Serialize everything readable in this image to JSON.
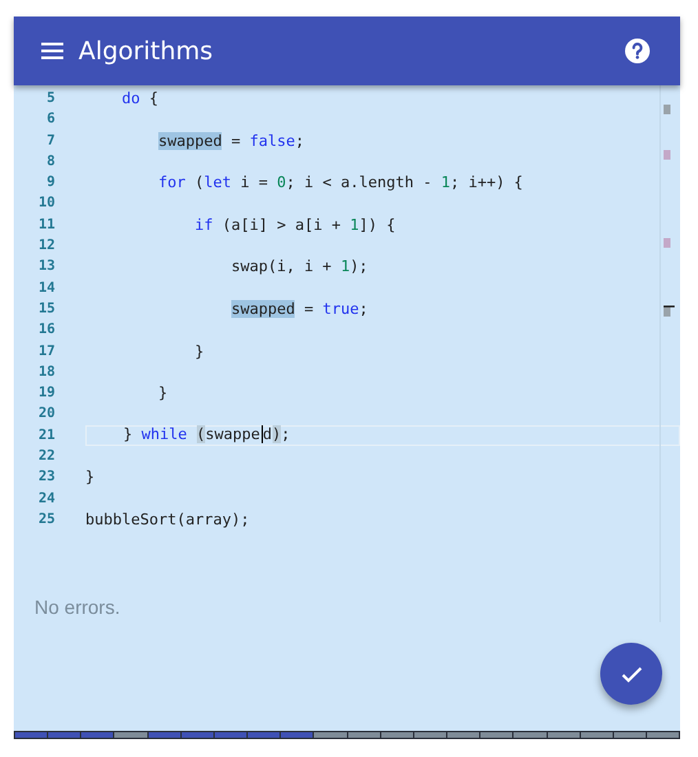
{
  "app_bar": {
    "title": "Algorithms"
  },
  "editor": {
    "lines": [
      {
        "number": "5",
        "current": false,
        "tokens": [
          {
            "text": "    do",
            "kind": "keyword"
          },
          {
            "text": " {",
            "kind": "plain"
          }
        ]
      },
      {
        "number": "6",
        "current": false
      },
      {
        "number": "7",
        "current": false,
        "tokens": [
          {
            "text": "        swapped",
            "kind": "occurrence"
          },
          {
            "text": " = ",
            "kind": "plain"
          },
          {
            "text": "false",
            "kind": "keyword"
          },
          {
            "text": ";",
            "kind": "plain"
          }
        ]
      },
      {
        "number": "8",
        "current": false
      },
      {
        "number": "9",
        "current": false,
        "tokens": [
          {
            "text": "        for",
            "kind": "keyword"
          },
          {
            "text": " (",
            "kind": "plain"
          },
          {
            "text": "let",
            "kind": "keyword"
          },
          {
            "text": " i = ",
            "kind": "plain"
          },
          {
            "text": "0",
            "kind": "number"
          },
          {
            "text": "; i < a.length - ",
            "kind": "plain"
          },
          {
            "text": "1",
            "kind": "number"
          },
          {
            "text": "; i++) {",
            "kind": "plain"
          }
        ]
      },
      {
        "number": "10",
        "current": false
      },
      {
        "number": "11",
        "current": false,
        "tokens": [
          {
            "text": "            if",
            "kind": "keyword"
          },
          {
            "text": " (a[i] > a[i + ",
            "kind": "plain"
          },
          {
            "text": "1",
            "kind": "number"
          },
          {
            "text": "]) {",
            "kind": "plain"
          }
        ]
      },
      {
        "number": "12",
        "current": false
      },
      {
        "number": "13",
        "current": false,
        "tokens": [
          {
            "text": "                swap(i, i + ",
            "kind": "plain"
          },
          {
            "text": "1",
            "kind": "number"
          },
          {
            "text": ");",
            "kind": "plain"
          }
        ]
      },
      {
        "number": "14",
        "current": false
      },
      {
        "number": "15",
        "current": false,
        "tokens": [
          {
            "text": "                swapped",
            "kind": "occurrence"
          },
          {
            "text": " = ",
            "kind": "plain"
          },
          {
            "text": "true",
            "kind": "keyword"
          },
          {
            "text": ";",
            "kind": "plain"
          }
        ]
      },
      {
        "number": "16",
        "current": false
      },
      {
        "number": "17",
        "current": false,
        "tokens": [
          {
            "text": "            }",
            "kind": "plain"
          }
        ]
      },
      {
        "number": "18",
        "current": false
      },
      {
        "number": "19",
        "current": false,
        "tokens": [
          {
            "text": "        }",
            "kind": "plain"
          }
        ]
      },
      {
        "number": "20",
        "current": false
      },
      {
        "number": "21",
        "current": true,
        "tokens": [
          {
            "text": "    } ",
            "kind": "plain"
          },
          {
            "text": "while ",
            "kind": "keyword"
          },
          {
            "text": "(",
            "kind": "bracket"
          },
          {
            "text": "swappe",
            "kind": "plain",
            "caret_after": true
          },
          {
            "text": "d",
            "kind": "plain"
          },
          {
            "text": ")",
            "kind": "bracket"
          },
          {
            "text": ";",
            "kind": "plain"
          }
        ]
      },
      {
        "number": "22",
        "current": false
      },
      {
        "number": "23",
        "current": false,
        "tokens": [
          {
            "text": "}",
            "kind": "plain"
          }
        ]
      },
      {
        "number": "24",
        "current": false
      },
      {
        "number": "25",
        "current": false,
        "tokens": [
          {
            "text": "bubbleSort(array);",
            "kind": "plain"
          }
        ]
      }
    ]
  },
  "status": {
    "message": "No errors."
  },
  "progress": {
    "steps": [
      {
        "completed": true
      },
      {
        "completed": true
      },
      {
        "completed": true
      },
      {
        "completed": false
      },
      {
        "completed": true
      },
      {
        "completed": true
      },
      {
        "completed": true
      },
      {
        "completed": true
      },
      {
        "completed": true
      },
      {
        "completed": false
      },
      {
        "completed": false
      },
      {
        "completed": false
      },
      {
        "completed": false
      },
      {
        "completed": false
      },
      {
        "completed": false
      },
      {
        "completed": false
      },
      {
        "completed": false
      },
      {
        "completed": false
      },
      {
        "completed": false
      },
      {
        "completed": false
      }
    ]
  }
}
